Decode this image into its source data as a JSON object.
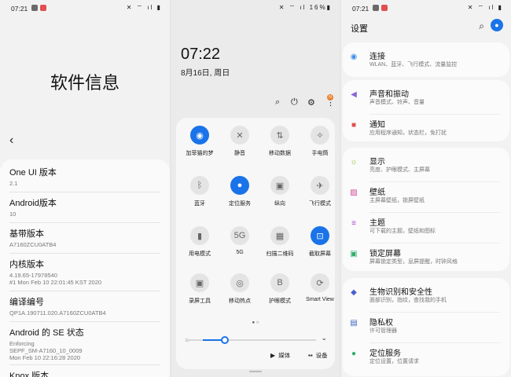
{
  "colors": {
    "accent": "#1a73e8",
    "notif_red": "#e05050",
    "orange": "#e8802c"
  },
  "panel1": {
    "status": {
      "time": "07:21",
      "right": "✕ ⌔ ıl ▮"
    },
    "title": "软件信息",
    "items": [
      {
        "label": "One UI 版本",
        "value": "2.1"
      },
      {
        "label": "Android版本",
        "value": "10"
      },
      {
        "label": "基带版本",
        "value": "A7160ZCU0ATB4"
      },
      {
        "label": "内核版本",
        "value": "4.19.65-17978540\n#1 Mon Feb 10 22:01:45 KST 2020"
      },
      {
        "label": "编译编号",
        "value": "QP1A.190711.020.A7160ZCU0ATB4"
      },
      {
        "label": "Android 的 SE 状态",
        "value": "Enforcing\nSEPF_SM-A7160_10_0009\nMon Feb 10 22:16:28 2020"
      },
      {
        "label": "Knox 版本",
        "value": ""
      }
    ]
  },
  "panel2": {
    "status": {
      "right": "✕ ⌔ ıl 16%▮"
    },
    "time": "07:22",
    "date": "8月16日, 周日",
    "badge": "N",
    "tiles": [
      {
        "label": "加菲猫的梦",
        "icon": "wifi-icon",
        "glyph": "◉",
        "on": true
      },
      {
        "label": "静音",
        "icon": "mute-icon",
        "glyph": "✕",
        "on": false
      },
      {
        "label": "移动数据",
        "icon": "mobile-data-icon",
        "glyph": "⇅",
        "on": false
      },
      {
        "label": "手电筒",
        "icon": "flashlight-icon",
        "glyph": "✧",
        "on": false
      },
      {
        "label": "蓝牙",
        "icon": "bluetooth-icon",
        "glyph": "ᛒ",
        "on": false
      },
      {
        "label": "定位服务",
        "icon": "location-icon",
        "glyph": "●",
        "on": true
      },
      {
        "label": "纵向",
        "icon": "portrait-icon",
        "glyph": "▣",
        "on": false
      },
      {
        "label": "飞行模式",
        "icon": "airplane-icon",
        "glyph": "✈",
        "on": false
      },
      {
        "label": "用电模式",
        "icon": "power-mode-icon",
        "glyph": "▮",
        "on": false
      },
      {
        "label": "5G",
        "icon": "5g-icon",
        "glyph": "5G",
        "on": false
      },
      {
        "label": "扫描二维码",
        "icon": "qr-code-icon",
        "glyph": "▦",
        "on": false
      },
      {
        "label": "截取屏幕",
        "icon": "screenshot-icon",
        "glyph": "⊡",
        "on": true
      },
      {
        "label": "录屏工具",
        "icon": "screen-recorder-icon",
        "glyph": "▣",
        "on": false
      },
      {
        "label": "移动热点",
        "icon": "hotspot-icon",
        "glyph": "◎",
        "on": false
      },
      {
        "label": "护眼模式",
        "icon": "eye-comfort-icon",
        "glyph": "B",
        "on": false
      },
      {
        "label": "Smart View",
        "icon": "smart-view-icon",
        "glyph": "⟳",
        "on": false
      }
    ],
    "brightness": 0.2,
    "media_label": "媒体",
    "devices_label": "设备"
  },
  "panel3": {
    "status": {
      "time": "07:21",
      "right": "✕ ⌔ ıl ▮"
    },
    "title": "设置",
    "groups": [
      [
        {
          "title": "连接",
          "sub": "WLAN、蓝牙、飞行模式、流量监控",
          "icon": "wifi-icon",
          "glyph": "◉",
          "color": "#3f8ee8"
        }
      ],
      [
        {
          "title": "声音和振动",
          "sub": "声音模式、铃声、音量",
          "icon": "sound-icon",
          "glyph": "◀",
          "color": "#8a64d8"
        },
        {
          "title": "通知",
          "sub": "应用程序通知，状态栏，免打扰",
          "icon": "notification-icon",
          "glyph": "■",
          "color": "#e05050"
        }
      ],
      [
        {
          "title": "显示",
          "sub": "亮度、护眼模式、主屏幕",
          "icon": "display-icon",
          "glyph": "☼",
          "color": "#8fbf2a"
        },
        {
          "title": "壁纸",
          "sub": "主屏幕壁纸，锁屏壁纸",
          "icon": "wallpaper-icon",
          "glyph": "▨",
          "color": "#d04a98"
        },
        {
          "title": "主题",
          "sub": "可下载的主题，壁纸和图标",
          "icon": "themes-icon",
          "glyph": "≡",
          "color": "#b14ad0"
        },
        {
          "title": "锁定屏幕",
          "sub": "屏幕锁定类型，息屏提醒，时钟风格",
          "icon": "lock-screen-icon",
          "glyph": "▣",
          "color": "#2fae6a"
        }
      ],
      [
        {
          "title": "生物识别和安全性",
          "sub": "面部识别，指纹，查找我的手机",
          "icon": "shield-icon",
          "glyph": "◆",
          "color": "#4a5fd0"
        },
        {
          "title": "隐私权",
          "sub": "许可管理器",
          "icon": "privacy-icon",
          "glyph": "▤",
          "color": "#3a66c8"
        },
        {
          "title": "定位服务",
          "sub": "定位设置，位置请求",
          "icon": "location-icon",
          "glyph": "●",
          "color": "#2fae6a"
        }
      ]
    ]
  }
}
